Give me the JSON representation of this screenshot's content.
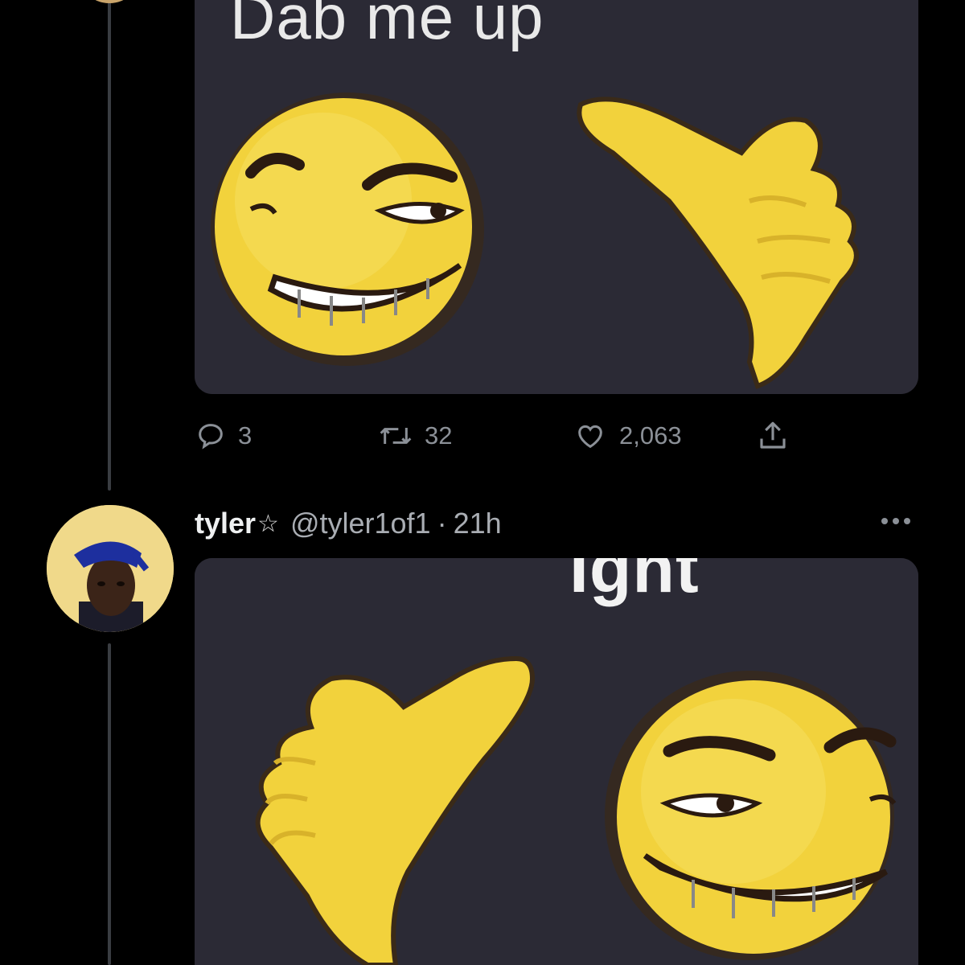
{
  "first_tweet": {
    "media_caption": "Dab me up",
    "actions": {
      "reply_count": "3",
      "retweet_count": "32",
      "like_count": "2,063"
    }
  },
  "reply_tweet": {
    "display_name": "tyler",
    "name_suffix": "☆",
    "handle": "@tyler1of1",
    "separator": "·",
    "time": "21h",
    "media_caption": "Ight"
  },
  "icons": [
    "reply-icon",
    "retweet-icon",
    "like-icon",
    "share-icon",
    "more-icon"
  ],
  "colors": {
    "background": "#000000",
    "muted_text": "#8b9097",
    "thread_line": "#3a3d42",
    "emoji_yellow": "#f2d23c",
    "media_bg": "#2b2a35"
  }
}
